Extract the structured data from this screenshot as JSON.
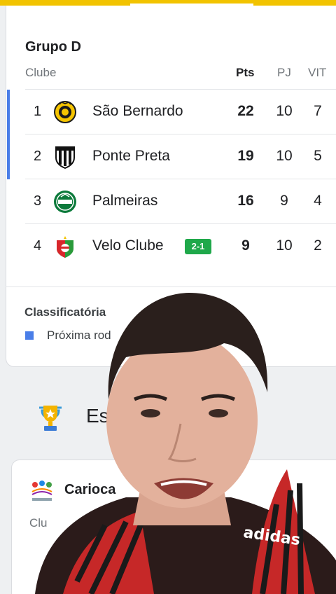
{
  "group": {
    "title": "Grupo D",
    "headers": {
      "club": "Clube",
      "pts": "Pts",
      "pj": "PJ",
      "vit": "VIT"
    },
    "rows": [
      {
        "pos": "1",
        "name": "São Bernardo",
        "pts": "22",
        "pj": "10",
        "vit": "7",
        "qualified": true,
        "live": ""
      },
      {
        "pos": "2",
        "name": "Ponte Preta",
        "pts": "19",
        "pj": "10",
        "vit": "5",
        "qualified": true,
        "live": ""
      },
      {
        "pos": "3",
        "name": "Palmeiras",
        "pts": "16",
        "pj": "9",
        "vit": "4",
        "qualified": false,
        "live": ""
      },
      {
        "pos": "4",
        "name": "Velo Clube",
        "pts": "9",
        "pj": "10",
        "vit": "2",
        "qualified": false,
        "live": "2-1"
      }
    ]
  },
  "classification": {
    "title": "Classificatória",
    "legend": "Próxima rod"
  },
  "section": {
    "title": "Esp"
  },
  "carioca": {
    "title": "Carioca",
    "club_header": "Clu"
  },
  "colors": {
    "top_bar": "#f2c300",
    "qualified": "#4a7ee8",
    "live_badge": "#1fa84a"
  },
  "icons": [
    "sao-bernardo-crest-icon",
    "ponte-preta-crest-icon",
    "palmeiras-crest-icon",
    "velo-clube-crest-icon",
    "trophy-icon",
    "carioca-logo-icon"
  ]
}
